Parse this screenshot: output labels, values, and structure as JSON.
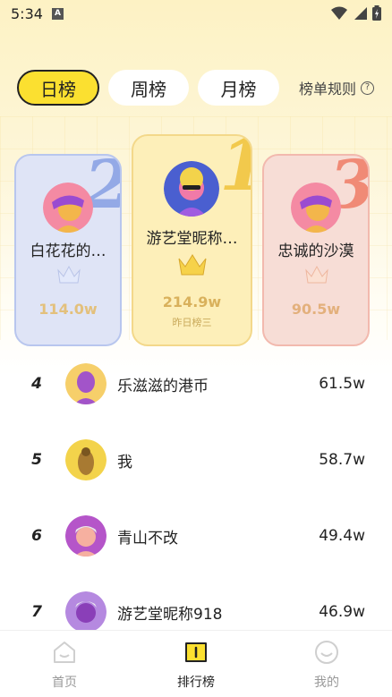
{
  "status_bar": {
    "time": "5:34",
    "badge": "A"
  },
  "tabs": [
    {
      "label": "日榜",
      "active": true
    },
    {
      "label": "周榜",
      "active": false
    },
    {
      "label": "月榜",
      "active": false
    }
  ],
  "rules": {
    "label": "榜单规则",
    "icon": "?"
  },
  "podium": {
    "first": {
      "rank": "1",
      "name": "游艺堂昵称…",
      "score": "214.9w",
      "sub": "昨日榜三",
      "rank_color": "#f2c94c",
      "score_color": "#d9b15c"
    },
    "second": {
      "rank": "2",
      "name": "白花花的…",
      "score": "114.0w",
      "rank_color": "#93a9e6",
      "score_color": "#e3c07c"
    },
    "third": {
      "rank": "3",
      "name": "忠诚的沙漠",
      "score": "90.5w",
      "rank_color": "#f08a76",
      "score_color": "#e3b07c"
    }
  },
  "list": [
    {
      "rank": "4",
      "name": "乐滋滋的港币",
      "score": "61.5w"
    },
    {
      "rank": "5",
      "name": "我",
      "score": "58.7w"
    },
    {
      "rank": "6",
      "name": "青山不改",
      "score": "49.4w"
    },
    {
      "rank": "7",
      "name": "游艺堂昵称918",
      "score": "46.9w"
    }
  ],
  "bottom_nav": [
    {
      "label": "首页",
      "icon": "home-icon",
      "active": false
    },
    {
      "label": "排行榜",
      "icon": "ranking-icon",
      "active": true
    },
    {
      "label": "我的",
      "icon": "profile-icon",
      "active": false
    }
  ],
  "colors": {
    "accent": "#fbe030"
  }
}
